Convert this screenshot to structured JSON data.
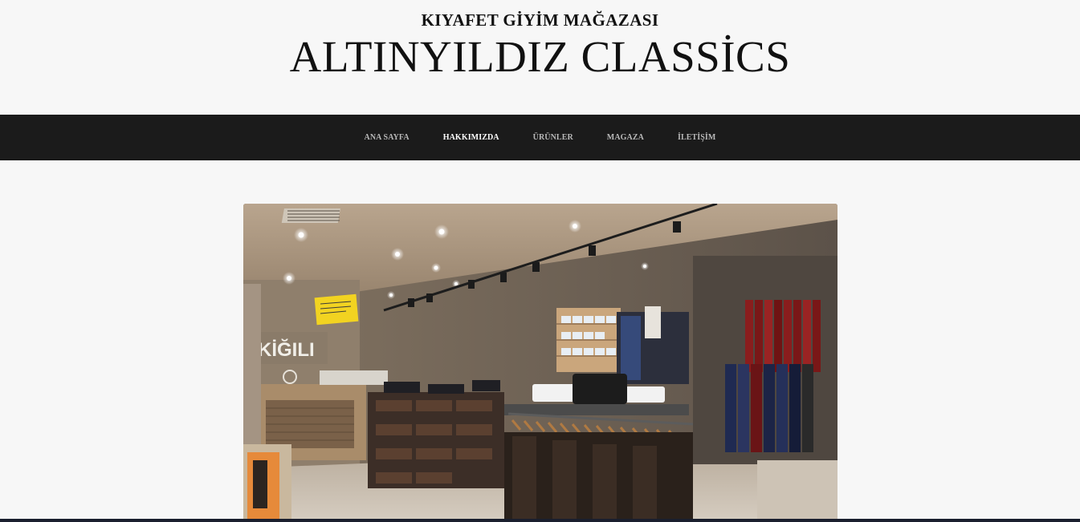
{
  "header": {
    "subtitle": "KIYAFET GİYİM MAĞAZASI",
    "title": "ALTINYILDIZ CLASSİCS"
  },
  "nav": {
    "items": [
      {
        "label": "ANA SAYFA",
        "active": false
      },
      {
        "label": "HAKKIMIZDA",
        "active": true
      },
      {
        "label": "ÜRÜNLER",
        "active": false
      },
      {
        "label": "MAGAZA",
        "active": false
      },
      {
        "label": "İLETİŞİM",
        "active": false
      }
    ]
  },
  "hero": {
    "store_sign": "KİĞILI"
  },
  "colors": {
    "background": "#f7f7f7",
    "nav_background": "#1b1b1b",
    "nav_text": "#b9b9b9",
    "nav_active": "#ffffff"
  }
}
